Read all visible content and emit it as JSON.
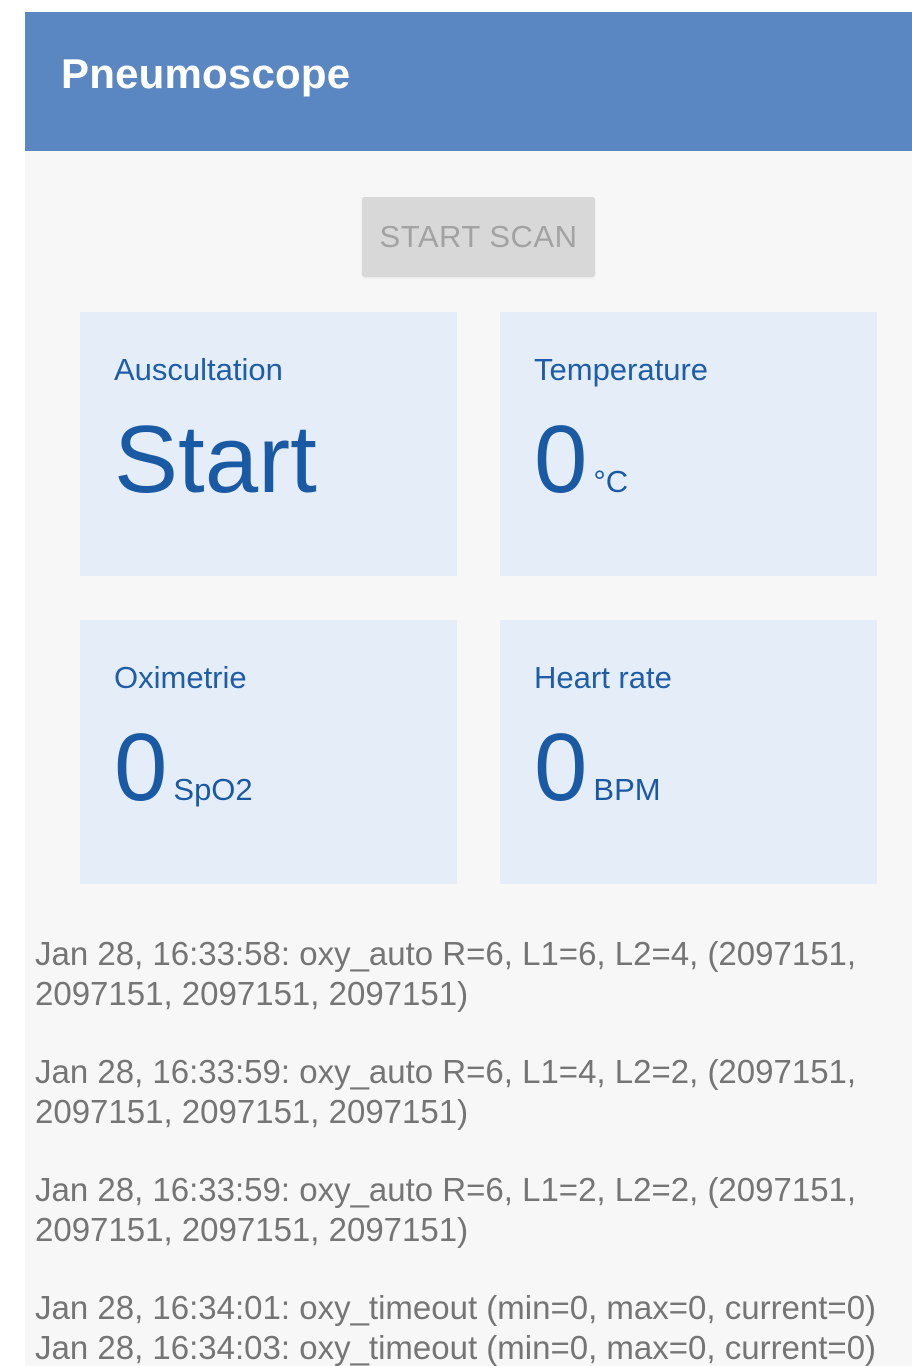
{
  "app_bar": {
    "title": "Pneumoscope"
  },
  "scan_button": {
    "label": "START SCAN",
    "enabled": false
  },
  "tiles": {
    "auscultation": {
      "label": "Auscultation",
      "value": "Start",
      "unit": ""
    },
    "temperature": {
      "label": "Temperature",
      "value": "0",
      "unit": "°C"
    },
    "oximetrie": {
      "label": "Oximetrie",
      "value": "0",
      "unit": "SpO2"
    },
    "heart_rate": {
      "label": "Heart rate",
      "value": "0",
      "unit": "BPM"
    }
  },
  "log": [
    "Jan 28, 16:33:58: oxy_auto R=6, L1=6, L2=4, (2097151,\n2097151, 2097151, 2097151)",
    "Jan 28, 16:33:59: oxy_auto R=6, L1=4, L2=2, (2097151,\n2097151, 2097151, 2097151)",
    "Jan 28, 16:33:59: oxy_auto R=6, L1=2, L2=2, (2097151,\n2097151, 2097151, 2097151)",
    "Jan 28, 16:34:01: oxy_timeout (min=0, max=0, current=0)",
    "Jan 28, 16:34:03: oxy_timeout (min=0, max=0, current=0)"
  ],
  "colors": {
    "app_bar": "#5a87c2",
    "tile_background": "#e5eef8",
    "accent_text": "#1a5aa5",
    "log_text": "#757575",
    "button_disabled": "#d8d8d8"
  }
}
